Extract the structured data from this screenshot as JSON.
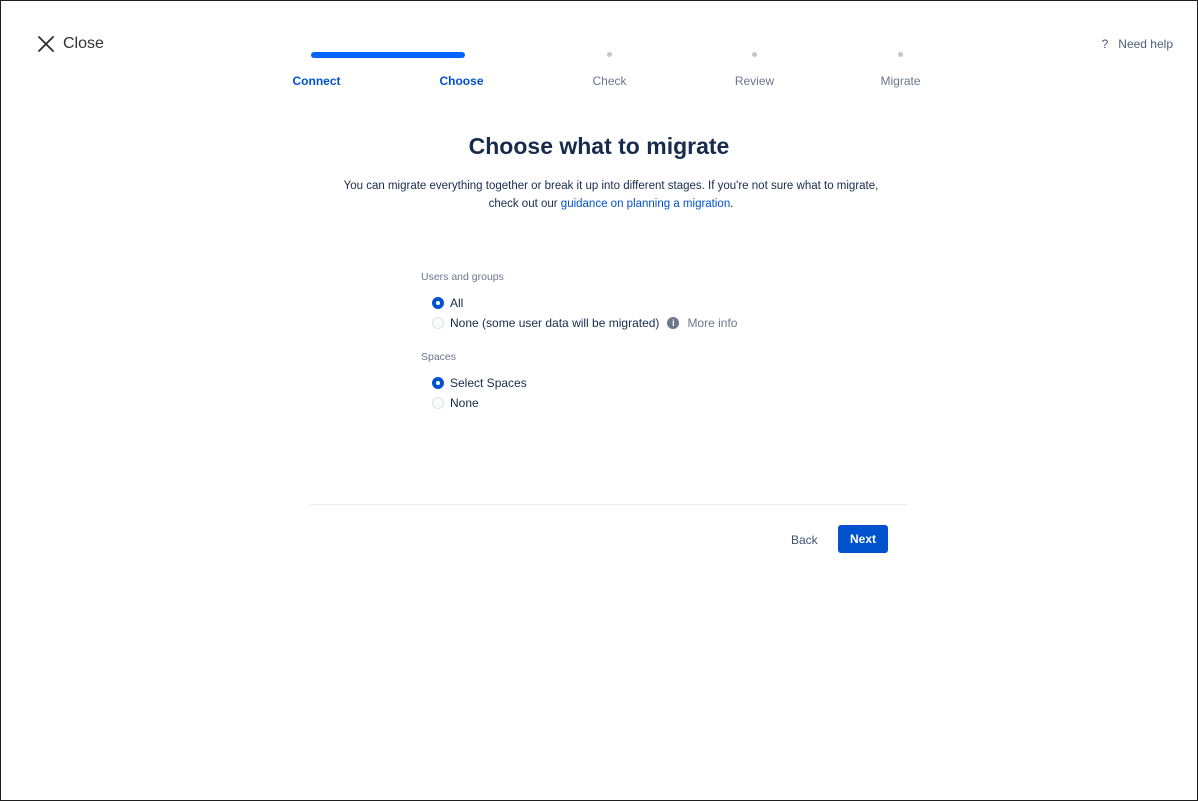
{
  "header": {
    "close_label": "Close",
    "help_icon": "?",
    "help_label": "Need help"
  },
  "stepper": {
    "steps": [
      {
        "label": "Connect",
        "state": "done"
      },
      {
        "label": "Choose",
        "state": "current"
      },
      {
        "label": "Check",
        "state": "upcoming"
      },
      {
        "label": "Review",
        "state": "upcoming"
      },
      {
        "label": "Migrate",
        "state": "upcoming"
      }
    ]
  },
  "main": {
    "title": "Choose what to migrate",
    "subtitle_pre": "You can migrate everything together or break it up into different stages. If you're not sure what to migrate, check out our ",
    "subtitle_link": "guidance on planning a migration",
    "subtitle_post": "."
  },
  "form": {
    "users": {
      "label": "Users and groups",
      "options": [
        {
          "label": "All",
          "selected": true
        },
        {
          "label": "None (some user data will be migrated)",
          "selected": false
        }
      ],
      "info_icon": "i",
      "more_info": "More info"
    },
    "spaces": {
      "label": "Spaces",
      "options": [
        {
          "label": "Select Spaces",
          "selected": true
        },
        {
          "label": "None",
          "selected": false
        }
      ]
    }
  },
  "footer": {
    "back_label": "Back",
    "next_label": "Next"
  },
  "colors": {
    "accent": "#0052cc",
    "progress": "#0065ff",
    "text": "#172b4d",
    "muted": "#6b778c"
  }
}
